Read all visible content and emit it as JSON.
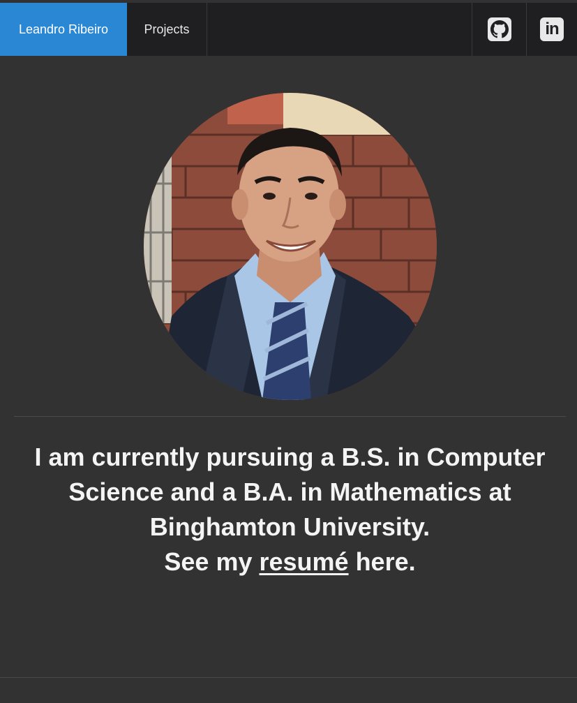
{
  "nav": {
    "brand_label": "Leandro Ribeiro",
    "projects_label": "Projects",
    "github_icon": "github-icon",
    "linkedin_label": "in",
    "brand_color": "#2a87d3"
  },
  "profile": {
    "photo_alt": "Profile photo"
  },
  "bio": {
    "line1": "I am currently pursuing a B.S. in Computer",
    "line2": "Science and a B.A. in Mathematics at",
    "line3": "Binghamton University.",
    "resume_prefix": "See my ",
    "resume_link": "resumé",
    "resume_suffix": " here."
  }
}
